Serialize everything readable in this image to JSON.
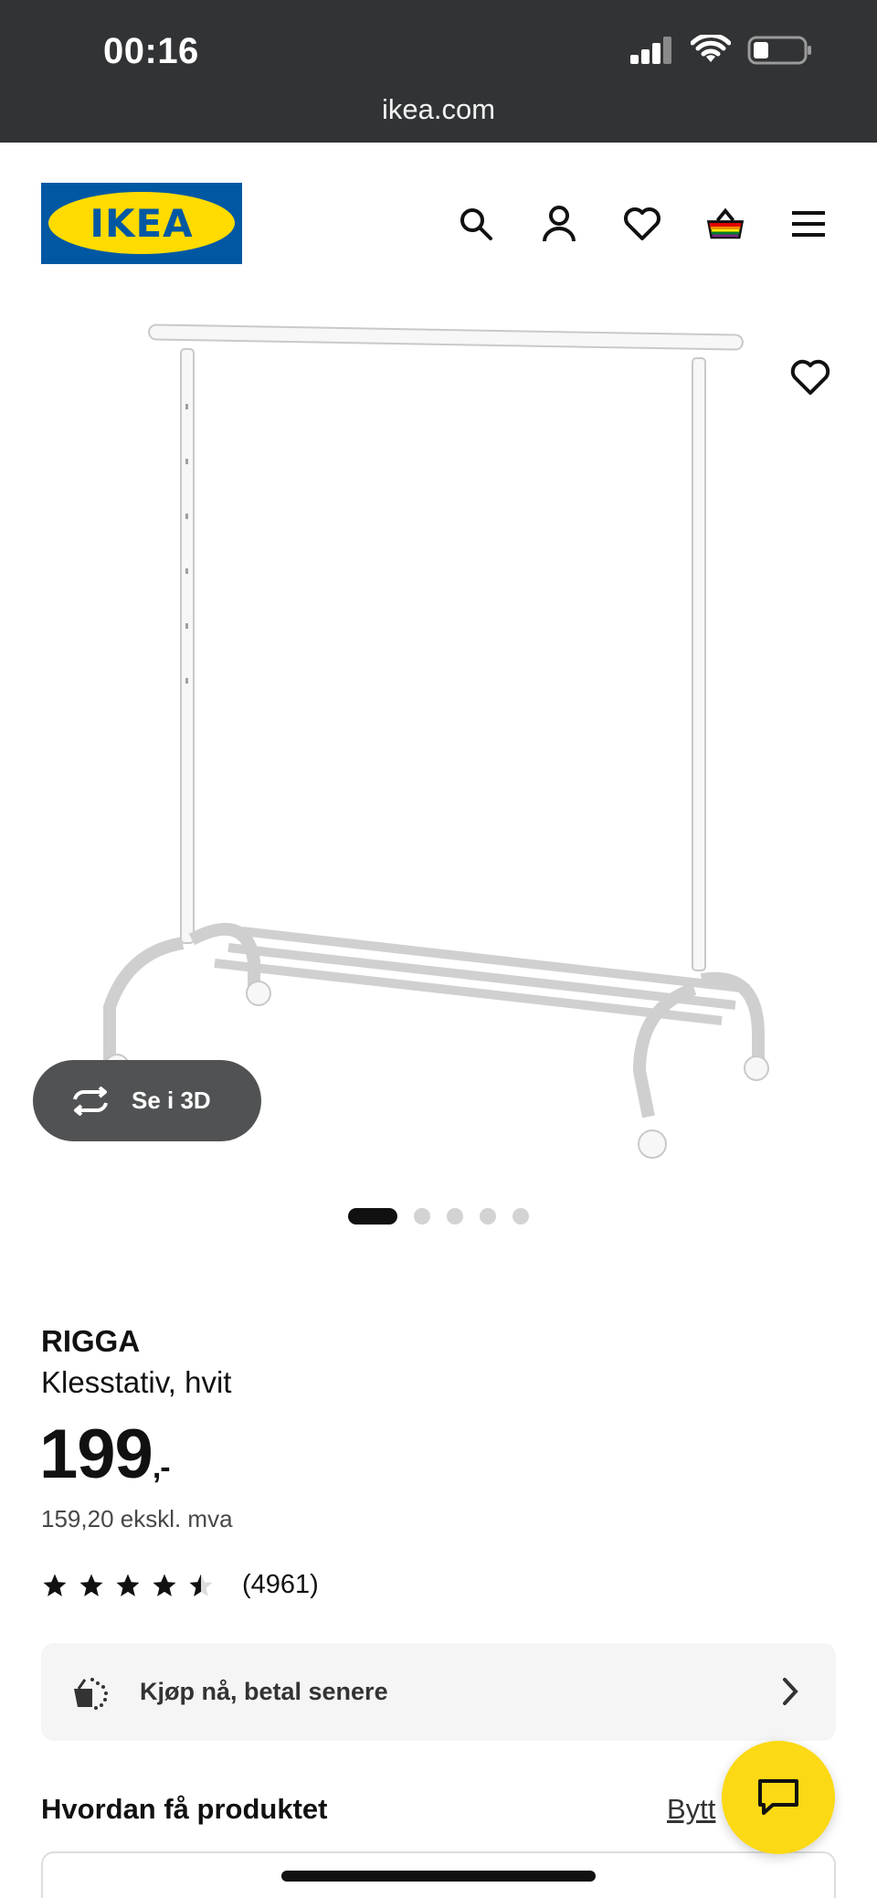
{
  "status_bar": {
    "time": "00:16",
    "url": "ikea.com",
    "icons": [
      "cellular-signal-icon",
      "wifi-icon",
      "battery-icon"
    ]
  },
  "header": {
    "logo_text": "IKEA",
    "brand_colors": {
      "blue": "#0058a3",
      "yellow": "#ffdb00"
    },
    "icons": [
      "search-icon",
      "account-icon",
      "heart-icon",
      "shopping-bag-icon",
      "menu-icon"
    ]
  },
  "gallery": {
    "see_3d_label": "Se i 3D",
    "image_count": 5,
    "active_image_index": 0
  },
  "product": {
    "name": "RIGGA",
    "description": "Klesstativ, hvit",
    "price_integer": "199",
    "price_suffix": ",-",
    "price_ex_vat": "159,20 ekskl. mva",
    "rating": 4.5,
    "review_count": "(4961)"
  },
  "bnpl": {
    "label": "Kjøp nå, betal senere"
  },
  "delivery": {
    "heading": "Hvordan få produktet",
    "change_store_label": "Bytt"
  },
  "chat": {
    "accent": "#fbd914"
  }
}
